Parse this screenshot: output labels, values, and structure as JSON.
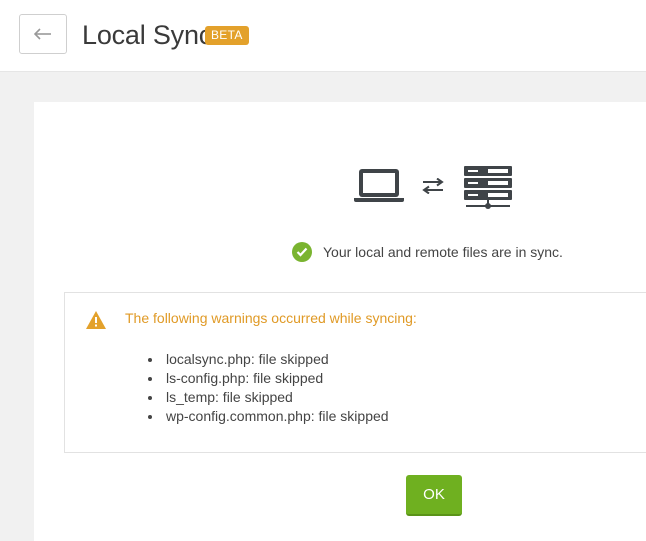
{
  "header": {
    "title": "Local Sync",
    "badge": "BETA",
    "back_icon": "arrow-left-icon"
  },
  "sync": {
    "status_text": "Your local and remote files are in sync.",
    "icons": [
      "laptop-icon",
      "sync-arrows-icon",
      "server-icon"
    ]
  },
  "warnings": {
    "title": "The following warnings occurred while syncing:",
    "items": [
      "localsync.php: file skipped",
      "ls-config.php: file skipped",
      "ls_temp: file skipped",
      "wp-config.common.php: file skipped"
    ]
  },
  "actions": {
    "ok_label": "OK"
  },
  "colors": {
    "accent_green": "#6fb020",
    "warning_orange": "#e09a26",
    "beta_badge": "#e3a12b"
  }
}
